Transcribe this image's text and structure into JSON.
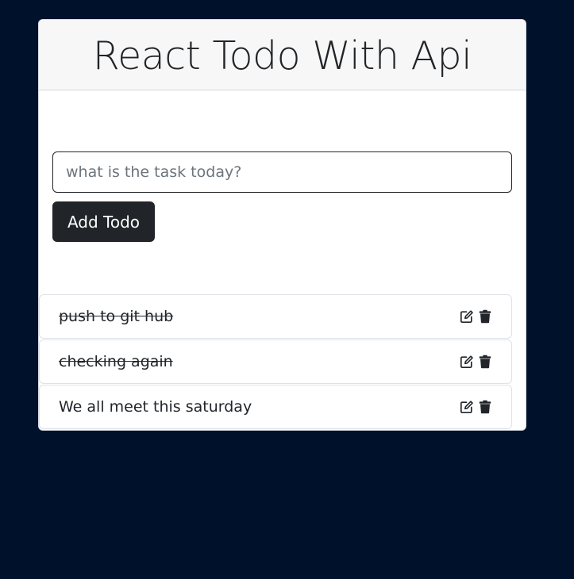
{
  "header": {
    "title": "React Todo With Api"
  },
  "form": {
    "placeholder": "what is the task today?",
    "value": "",
    "add_button_label": "Add Todo"
  },
  "todos": [
    {
      "text": "push to git hub",
      "completed": true
    },
    {
      "text": "checking again",
      "completed": true
    },
    {
      "text": "We all meet this saturday",
      "completed": false
    }
  ],
  "icons": {
    "edit": "edit-icon",
    "delete": "trash-icon"
  },
  "colors": {
    "page_background": "#00112c",
    "card_background": "#ffffff",
    "header_background": "#f7f7f7",
    "button_background": "#212529",
    "text": "#212529"
  }
}
